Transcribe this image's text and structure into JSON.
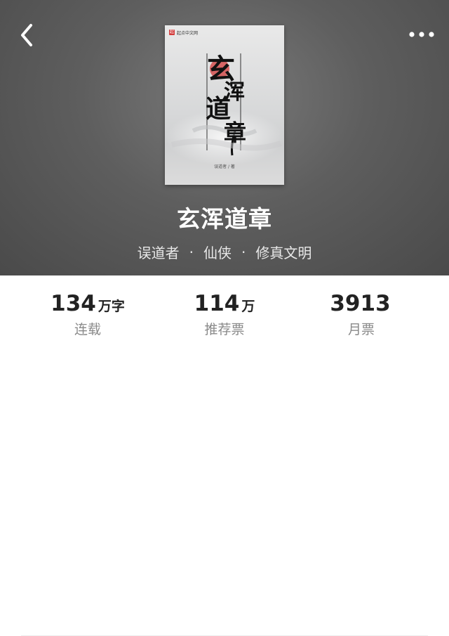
{
  "book": {
    "title": "玄浑道章",
    "cover": {
      "publisher": "起点中文网",
      "publisher_logo": "起",
      "calligraphy": [
        "玄",
        "浑",
        "道",
        "章"
      ],
      "author_line": "误道者 / 著"
    },
    "meta": {
      "author": "误道者",
      "separator": "·",
      "category": "仙侠",
      "subcategory": "修真文明"
    }
  },
  "nav": {
    "back_icon": "chevron-left-icon",
    "more_icon": "more-horizontal-icon"
  },
  "stats": [
    {
      "value": "134",
      "unit": "万字",
      "label": "连载"
    },
    {
      "value": "114",
      "unit": "万",
      "label": "推荐票"
    },
    {
      "value": "3913",
      "unit": "",
      "label": "月票"
    }
  ],
  "colors": {
    "hero_bg": "#5e5e5e",
    "title_text": "#ffffff",
    "stat_value": "#222222",
    "stat_label": "#8a8a8a",
    "cover_seal": "#d23b3b"
  }
}
